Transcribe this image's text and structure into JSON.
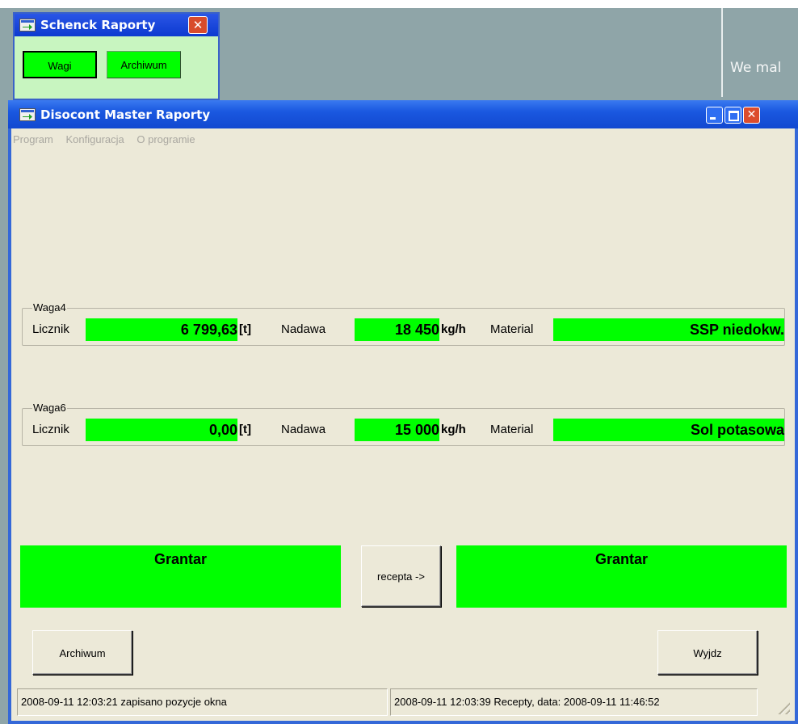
{
  "desktop": {
    "text": "We mal"
  },
  "schenck_window": {
    "title": "Schenck Raporty",
    "close_glyph": "✕",
    "buttons": {
      "wagi": "Wagi",
      "archiwum": "Archiwum"
    }
  },
  "main_window": {
    "title": "Disocont Master Raporty",
    "close_glyph": "✕",
    "menu": [
      "Program",
      "Konfiguracja",
      "O programie"
    ],
    "scales": [
      {
        "group": "Waga4",
        "licznik_label": "Licznik",
        "licznik_value": "6 799,63",
        "licznik_unit": "[t]",
        "nadawa_label": "Nadawa",
        "nadawa_value": "18 450",
        "nadawa_unit": "kg/h",
        "material_label": "Material",
        "material_value": "SSP niedokw."
      },
      {
        "group": "Waga6",
        "licznik_label": "Licznik",
        "licznik_value": "0,00",
        "licznik_unit": "[t]",
        "nadawa_label": "Nadawa",
        "nadawa_value": "15 000",
        "nadawa_unit": "kg/h",
        "material_label": "Material",
        "material_value": "Sol potasowa"
      }
    ],
    "recipe": {
      "left": "Grantar",
      "button": "recepta ->",
      "right": "Grantar"
    },
    "buttons": {
      "archiwum": "Archiwum",
      "wyjdz": "Wyjdz"
    },
    "status": {
      "left": "2008-09-11 12:03:21 zapisano pozycje okna",
      "right": "2008-09-11 12:03:39 Recepty, data: 2008-09-11 11:46:52"
    }
  },
  "colors": {
    "field_green": "#00ff00",
    "window_bg": "#ece9d8",
    "titlebar_blue": "#1a58e0",
    "desktop": "#8fa5a8"
  }
}
